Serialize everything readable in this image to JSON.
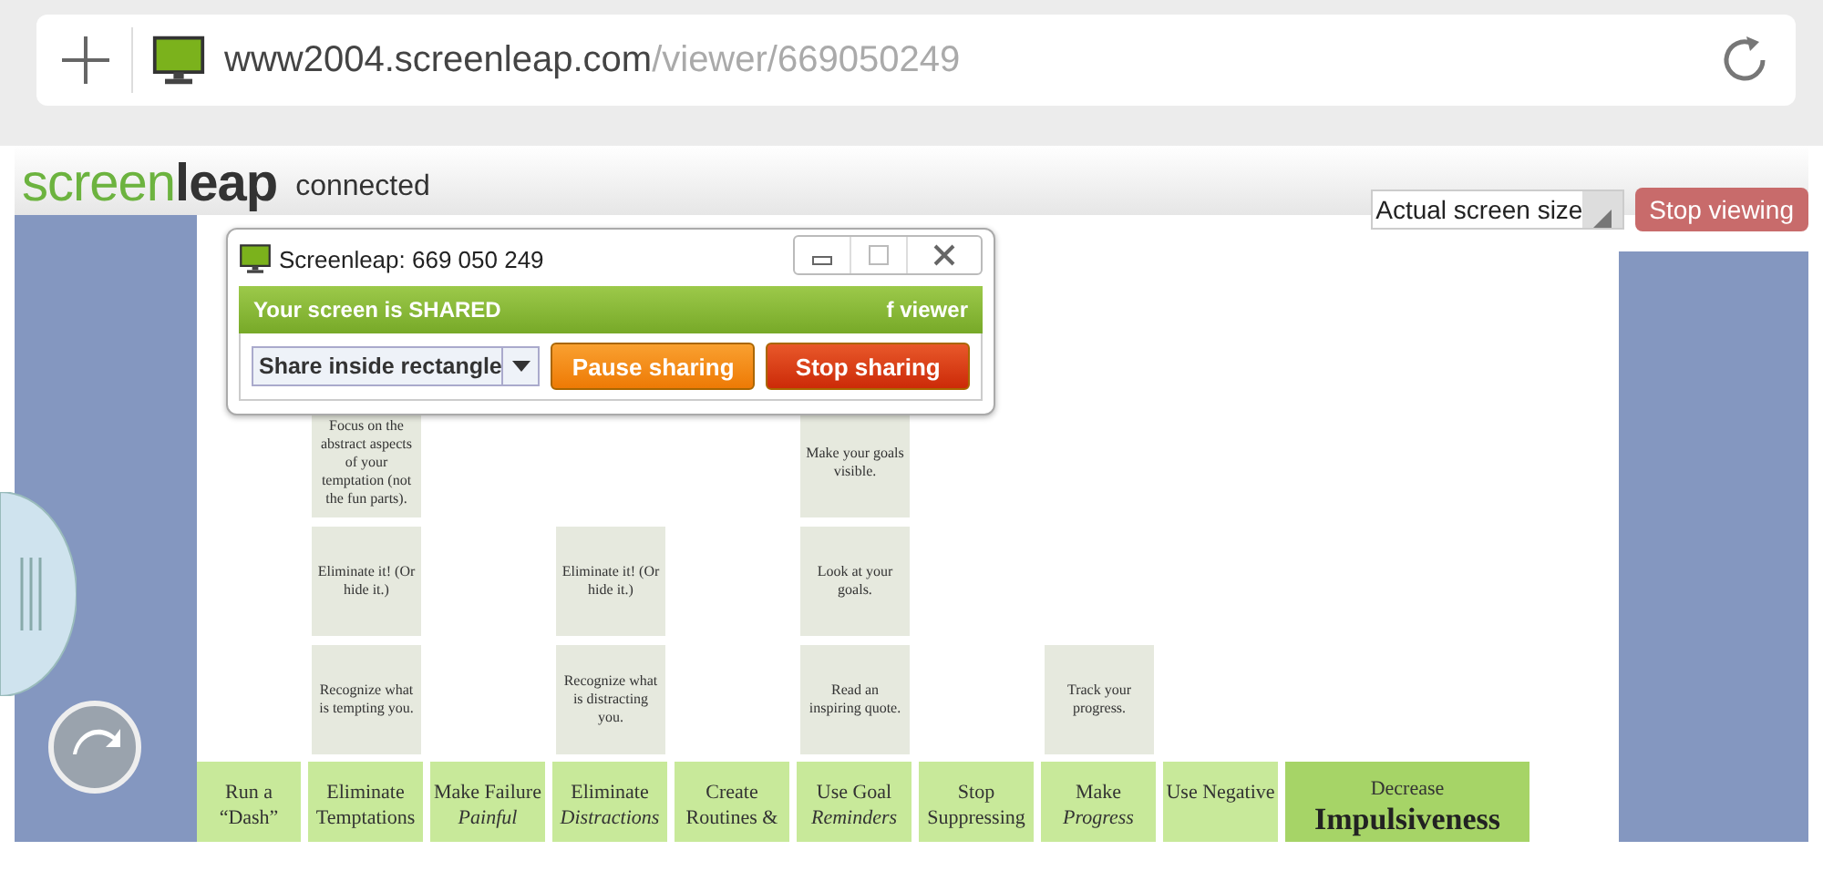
{
  "browser": {
    "address": {
      "host": "www2004.screenleap.com",
      "path": "/viewer/669050249"
    }
  },
  "viewer_bar": {
    "logo": "screen**leap**",
    "status": "connected",
    "zoom_select": {
      "value": "Actual screen size"
    },
    "buttons": [
      "Stop viewing"
    ]
  },
  "share_dialog": {
    "title": "Screenleap: 669 050 249",
    "banner": "Your screen is SHARED",
    "viewer_count": "f viewer",
    "mode_select": {
      "value": "Share inside rectangle"
    },
    "buttons": [
      {
        "label": "Pause sharing",
        "kind": "pause"
      },
      {
        "label": "Stop sharing",
        "kind": "stop"
      }
    ]
  },
  "diagram": {
    "columns": [
      {
        "kind": "strategy",
        "goal": "Run a “Dash”"
      },
      {
        "kind": "strategy",
        "goal": "Eliminate Temptations",
        "tips": [
          "Focus on the abstract aspects of your temptation (not the fun parts).",
          "Eliminate it! (Or hide it.)",
          "Recognize what is tempting you."
        ]
      },
      {
        "kind": "strategy",
        "goal": "Make Failure *Painful*"
      },
      {
        "kind": "strategy",
        "goal": "Eliminate *Distractions*",
        "tips": [
          "Eliminate it! (Or hide it.)",
          "Recognize what is distracting you."
        ]
      },
      {
        "kind": "strategy",
        "goal": "Create Routines &"
      },
      {
        "kind": "strategy",
        "goal": "Use Goal *Reminders*",
        "tips": [
          "Make your goals visible.",
          "Look at your goals.",
          "Read an inspiring quote."
        ]
      },
      {
        "kind": "strategy",
        "goal": "Stop Suppressing"
      },
      {
        "kind": "strategy",
        "goal": "Make *Progress*",
        "tips": [
          "Track your progress."
        ]
      },
      {
        "kind": "strategy",
        "goal": "Use Negative"
      },
      {
        "kind": "main",
        "goal": "Decrease **Impulsiveness**"
      }
    ]
  }
}
